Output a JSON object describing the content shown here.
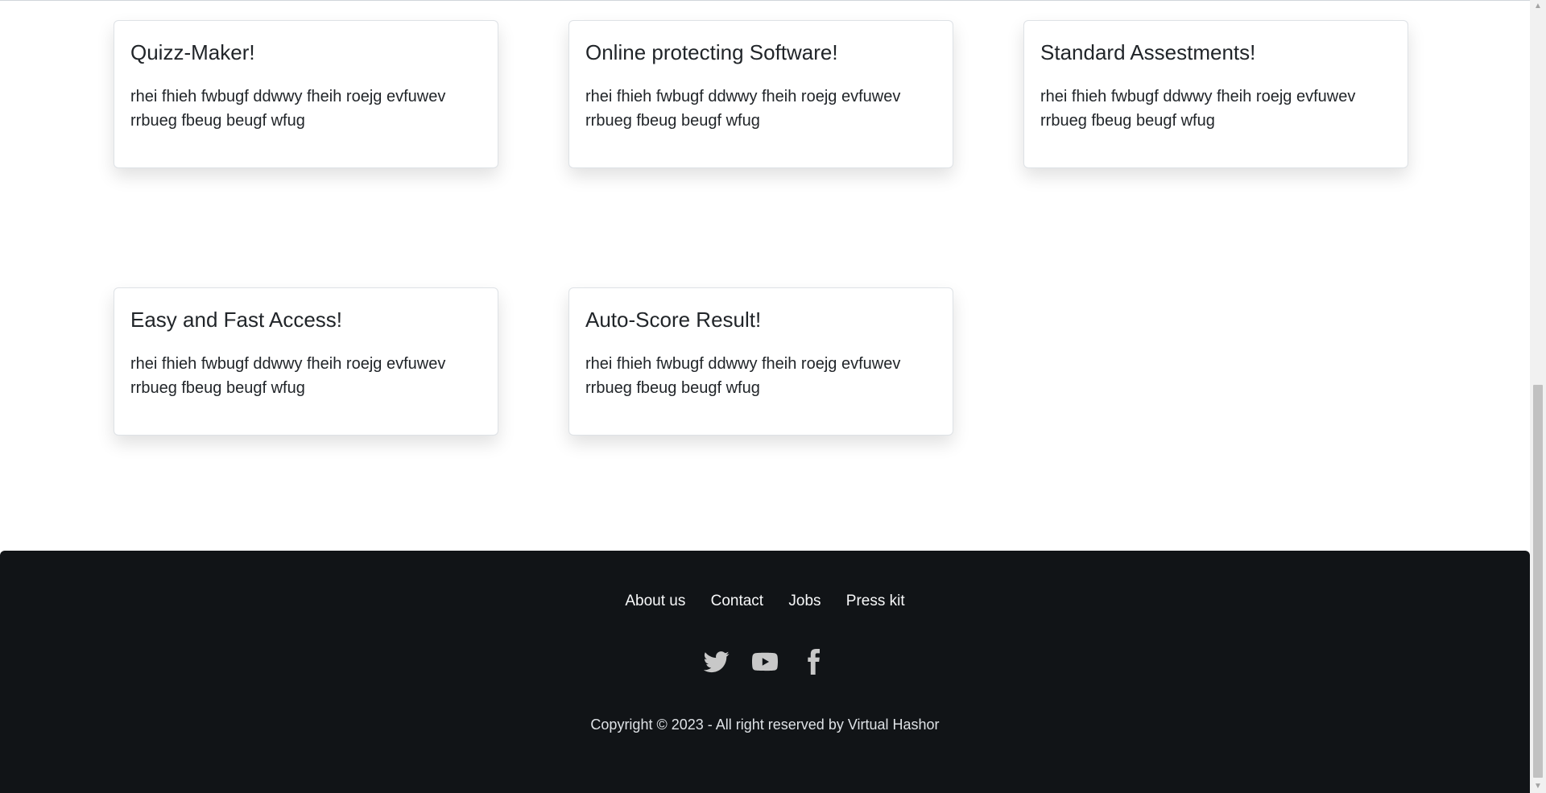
{
  "cards": [
    {
      "title": "Quizz-Maker!",
      "text": "rhei fhieh fwbugf ddwwy fheih roejg evfuwev rrbueg fbeug beugf wfug"
    },
    {
      "title": "Online protecting Software!",
      "text": "rhei fhieh fwbugf ddwwy fheih roejg evfuwev rrbueg fbeug beugf wfug"
    },
    {
      "title": "Standard Assestments!",
      "text": "rhei fhieh fwbugf ddwwy fheih roejg evfuwev rrbueg fbeug beugf wfug"
    },
    {
      "title": "Easy and Fast Access!",
      "text": "rhei fhieh fwbugf ddwwy fheih roejg evfuwev rrbueg fbeug beugf wfug"
    },
    {
      "title": "Auto-Score Result!",
      "text": "rhei fhieh fwbugf ddwwy fheih roejg evfuwev rrbueg fbeug beugf wfug"
    }
  ],
  "footer": {
    "links": [
      "About us",
      "Contact",
      "Jobs",
      "Press kit"
    ],
    "social_icons": [
      "twitter-icon",
      "youtube-icon",
      "facebook-icon"
    ],
    "copyright": "Copyright © 2023 - All right reserved by Virtual Hashor"
  },
  "colors": {
    "footer_bg": "#111417",
    "footer_text": "#f8f9fa",
    "icon_color": "#c8c8c8"
  }
}
